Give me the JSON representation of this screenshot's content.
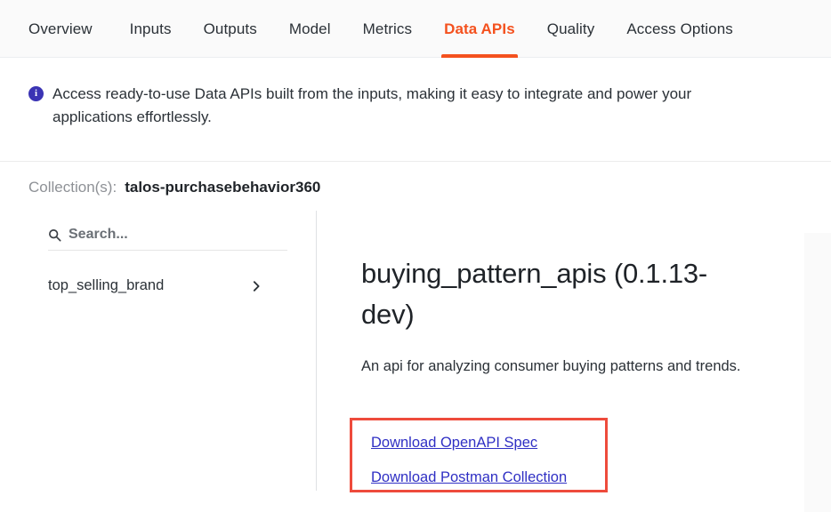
{
  "tabs": [
    {
      "label": "Overview",
      "active": false
    },
    {
      "label": "Inputs",
      "active": false
    },
    {
      "label": "Outputs",
      "active": false
    },
    {
      "label": "Model",
      "active": false
    },
    {
      "label": "Metrics",
      "active": false
    },
    {
      "label": "Data APIs",
      "active": true
    },
    {
      "label": "Quality",
      "active": false
    },
    {
      "label": "Access Options",
      "active": false
    }
  ],
  "banner": {
    "icon": "info-icon",
    "text": "Access ready-to-use Data APIs built from the inputs, making it easy to integrate and power your applications effortlessly."
  },
  "collection": {
    "label": "Collection(s):",
    "value": "talos-purchasebehavior360"
  },
  "sidebar": {
    "search": {
      "icon": "search-icon",
      "placeholder": "Search...",
      "value": ""
    },
    "items": [
      {
        "label": "top_selling_brand",
        "chevron": "chevron-right-icon"
      }
    ]
  },
  "detail": {
    "title": "buying_pattern_apis (0.1.13-dev)",
    "description": "An api for analyzing consumer buying patterns and trends.",
    "links": [
      {
        "label": "Download OpenAPI Spec"
      },
      {
        "label": "Download Postman Collection"
      }
    ]
  },
  "colors": {
    "accent": "#f4511e",
    "info": "#3b34b4",
    "link": "#2f2fc4",
    "highlight": "#ee4b3c",
    "panel_bg": "#fafafa"
  }
}
